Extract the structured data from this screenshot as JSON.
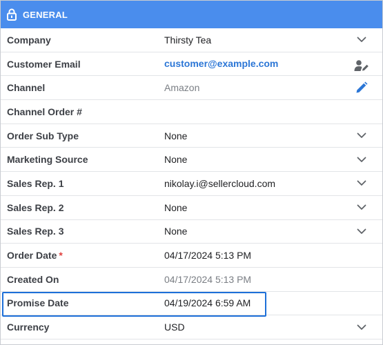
{
  "header": {
    "title": "GENERAL",
    "icon": "lock-icon",
    "color": "#4a8ded"
  },
  "fields": {
    "company": {
      "label": "Company",
      "value": "Thirsty Tea"
    },
    "customer_email": {
      "label": "Customer Email",
      "value": "customer@example.com"
    },
    "channel": {
      "label": "Channel",
      "value": "Amazon"
    },
    "channel_order": {
      "label": "Channel Order #",
      "value": ""
    },
    "order_sub_type": {
      "label": "Order Sub Type",
      "value": "None"
    },
    "marketing_source": {
      "label": "Marketing Source",
      "value": "None"
    },
    "sales_rep_1": {
      "label": "Sales Rep. 1",
      "value": "nikolay.i@sellercloud.com"
    },
    "sales_rep_2": {
      "label": "Sales Rep. 2",
      "value": "None"
    },
    "sales_rep_3": {
      "label": "Sales Rep. 3",
      "value": "None"
    },
    "order_date": {
      "label": "Order Date",
      "required_marker": "*",
      "value": "04/17/2024 5:13 PM"
    },
    "created_on": {
      "label": "Created On",
      "value": "04/17/2024 5:13 PM"
    },
    "promise_date": {
      "label": "Promise Date",
      "value": "04/19/2024 6:59 AM"
    },
    "currency": {
      "label": "Currency",
      "value": "USD"
    }
  },
  "colors": {
    "accent": "#4a8ded",
    "link": "#2b76d6",
    "highlight": "#1d6fd8",
    "required": "#e0413f"
  }
}
